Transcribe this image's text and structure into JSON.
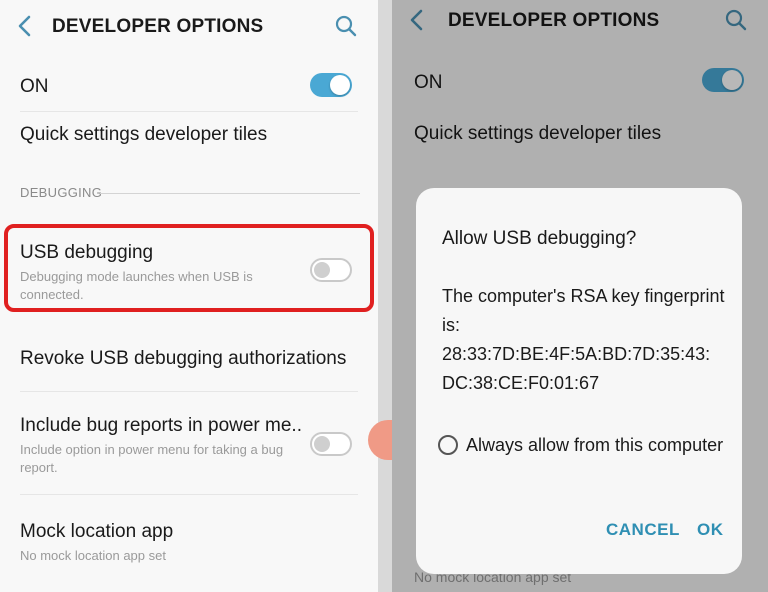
{
  "left": {
    "header": {
      "title": "DEVELOPER OPTIONS"
    },
    "master": {
      "label": "ON",
      "enabled": true
    },
    "quick_tiles": {
      "label": "Quick settings developer tiles"
    },
    "section": "DEBUGGING",
    "usb_debugging": {
      "label": "USB debugging",
      "desc": "Debugging mode launches when USB is connected.",
      "enabled": false
    },
    "revoke": {
      "label": "Revoke USB debugging authorizations"
    },
    "bug_reports": {
      "label": "Include bug reports in power me..",
      "desc": "Include option in power menu for taking a bug report.",
      "enabled": false
    },
    "mock_location": {
      "label": "Mock location app",
      "desc": "No mock location app set"
    }
  },
  "right": {
    "header": {
      "title": "DEVELOPER OPTIONS"
    },
    "master": {
      "label": "ON",
      "enabled": true
    },
    "quick_tiles": {
      "label": "Quick settings developer tiles"
    },
    "mock_sub": "No mock location app set",
    "dialog": {
      "title": "Allow USB debugging?",
      "body_line1": "The computer's RSA key fingerprint is:",
      "fingerprint": "28:33:7D:BE:4F:5A:BD:7D:35:43:DC:38:CE:F0:01:67",
      "checkbox_label": "Always allow from this computer",
      "cancel": "CANCEL",
      "ok": "OK"
    }
  },
  "colors": {
    "accent": "#4aa8d4",
    "highlight": "#e02020",
    "dialog_button": "#2f8fb3"
  }
}
